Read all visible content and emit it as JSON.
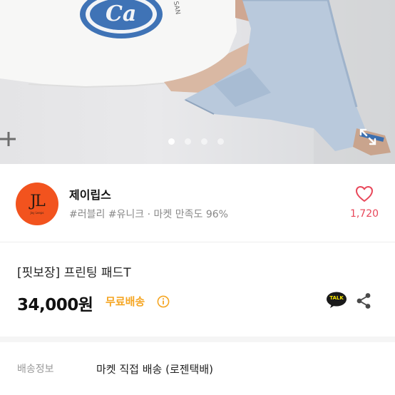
{
  "product_photo": {
    "shirt_print": "Ca",
    "shirt_side_text": "SAN",
    "carousel_total": 4,
    "carousel_active": 1
  },
  "seller": {
    "logo_text": "JL",
    "logo_sub": "Jay Leeps",
    "name": "제이립스",
    "tags": "#러블리 #유니크 · 마켓 만족도 96%",
    "like_count": "1,720"
  },
  "product": {
    "title": "[핏보장] 프린팅 패드T",
    "price": "34,000원",
    "shipping_badge": "무료배송"
  },
  "talk_label": "TALK",
  "shipping_info": {
    "label": "배송정보",
    "value": "마켓 직접 배송 (로젠택배)"
  },
  "colors": {
    "accent_orange": "#f5a623",
    "like_red": "#e8475a",
    "logo_bg": "#f2531e"
  }
}
